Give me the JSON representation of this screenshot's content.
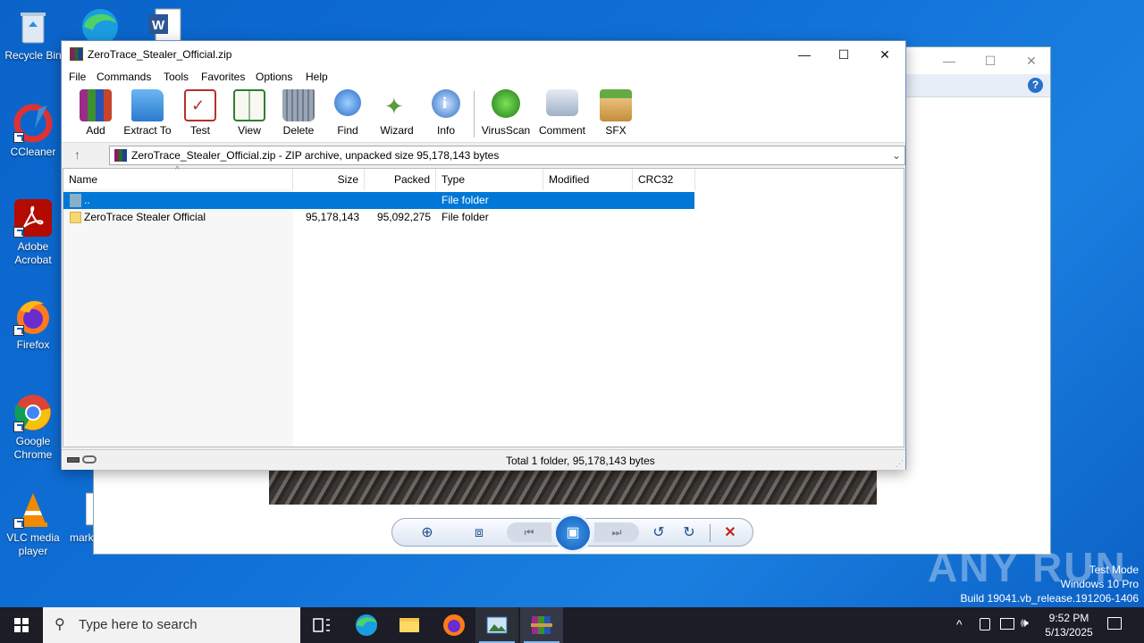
{
  "desktop": {
    "icons": [
      {
        "label": "Recycle Bin"
      },
      {
        "label": "CCleaner"
      },
      {
        "label": "Adobe Acrobat"
      },
      {
        "label": "Firefox"
      },
      {
        "label": "Google Chrome"
      },
      {
        "label": "VLC media player"
      },
      {
        "label": "mark"
      }
    ]
  },
  "rar": {
    "title": "ZeroTrace_Stealer_Official.zip",
    "menu": [
      "File",
      "Commands",
      "Tools",
      "Favorites",
      "Options",
      "Help"
    ],
    "toolbar": [
      "Add",
      "Extract To",
      "Test",
      "View",
      "Delete",
      "Find",
      "Wizard",
      "Info",
      "VirusScan",
      "Comment",
      "SFX"
    ],
    "address": "ZeroTrace_Stealer_Official.zip - ZIP archive, unpacked size 95,178,143 bytes",
    "columns": {
      "name": "Name",
      "size": "Size",
      "packed": "Packed",
      "type": "Type",
      "modified": "Modified",
      "crc": "CRC32"
    },
    "rows": [
      {
        "name": "..",
        "size": "",
        "packed": "",
        "type": "File folder"
      },
      {
        "name": "ZeroTrace Stealer Official",
        "size": "95,178,143",
        "packed": "95,092,275",
        "type": "File folder"
      }
    ],
    "status": "Total 1 folder, 95,178,143 bytes"
  },
  "watermark": {
    "logo": "ANY RUN",
    "line1": "Test Mode",
    "line2": "Windows 10 Pro",
    "line3": "Build 19041.vb_release.191206-1406"
  },
  "taskbar": {
    "search_placeholder": "Type here to search",
    "time": "9:52 PM",
    "date": "5/13/2025"
  },
  "colors": {
    "selection": "#0078d7",
    "desktop": "#0f6fd6",
    "taskbar": "#1c1d26"
  }
}
